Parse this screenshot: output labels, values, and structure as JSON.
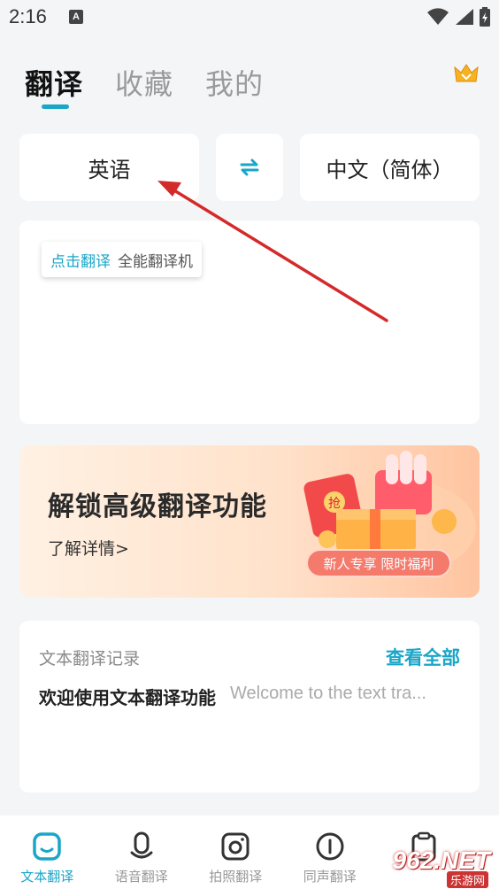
{
  "status": {
    "time": "2:16",
    "notif_letter": "A"
  },
  "tabs": [
    {
      "label": "翻译"
    },
    {
      "label": "收藏"
    },
    {
      "label": "我的"
    }
  ],
  "lang": {
    "source": "英语",
    "target": "中文（简体）"
  },
  "input": {
    "hint_accent": "点击翻译",
    "hint_text": "全能翻译机"
  },
  "promo": {
    "title": "解锁高级翻译功能",
    "link": "了解详情>",
    "badge": "新人专享 限时福利",
    "art_char": "抢"
  },
  "history": {
    "title": "文本翻译记录",
    "view_all": "查看全部",
    "source_text": "欢迎使用文本翻译功能",
    "translated_text": "Welcome to the text tra..."
  },
  "nav": [
    {
      "label": "文本翻译",
      "icon": "text-translate-icon"
    },
    {
      "label": "语音翻译",
      "icon": "microphone-icon"
    },
    {
      "label": "拍照翻译",
      "icon": "camera-icon"
    },
    {
      "label": "同声翻译",
      "icon": "simultaneous-icon"
    },
    {
      "label": "",
      "icon": "clipboard-icon"
    }
  ],
  "watermark": {
    "main": "962.NET",
    "sub": "乐游网"
  },
  "colors": {
    "accent": "#1aa6c8",
    "arrow": "#d42a2a",
    "promo_badge": "#f47a6c"
  }
}
